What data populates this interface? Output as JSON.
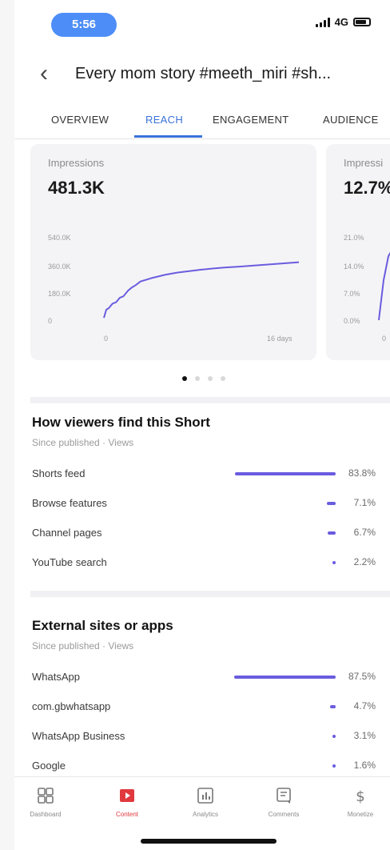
{
  "status_bar": {
    "time": "5:56",
    "network": "4G"
  },
  "header": {
    "title": "Every mom story  #meeth_miri #sh..."
  },
  "tabs": [
    {
      "label": "OVERVIEW"
    },
    {
      "label": "REACH"
    },
    {
      "label": "ENGAGEMENT"
    },
    {
      "label": "AUDIENCE"
    }
  ],
  "active_tab": "REACH",
  "cards": [
    {
      "label": "Impressions",
      "value": "481.3K",
      "chart_data": {
        "type": "line",
        "x": [
          0,
          0.2,
          0.4,
          0.7,
          1,
          1.3,
          1.6,
          2,
          2.3,
          2.6,
          3,
          4,
          5,
          6,
          7,
          8,
          9,
          10,
          11,
          12,
          13,
          14,
          15,
          16
        ],
        "y": [
          5,
          60,
          70,
          100,
          110,
          140,
          150,
          190,
          210,
          225,
          250,
          275,
          295,
          310,
          320,
          330,
          338,
          345,
          350,
          356,
          362,
          368,
          374,
          380
        ],
        "y_ticks": [
          "540.0K",
          "360.0K",
          "180.0K",
          "0"
        ],
        "x_ticks": [
          "0",
          "16 days"
        ],
        "ylim": [
          0,
          540
        ],
        "xlim": [
          0,
          16
        ],
        "color": "#6a5cdf"
      }
    },
    {
      "label": "Impressi",
      "value": "12.7%",
      "chart_data": {
        "type": "line",
        "y_ticks": [
          "21.0%",
          "14.0%",
          "7.0%",
          "0.0%"
        ],
        "x_ticks": [
          "0"
        ],
        "color": "#6a5cdf"
      }
    }
  ],
  "traffic_sources": {
    "title": "How viewers find this Short",
    "subtitle": "Since published · Views",
    "rows": [
      {
        "label": "Shorts feed",
        "percent": "83.8%",
        "value": 83.8
      },
      {
        "label": "Browse features",
        "percent": "7.1%",
        "value": 7.1
      },
      {
        "label": "Channel pages",
        "percent": "6.7%",
        "value": 6.7
      },
      {
        "label": "YouTube search",
        "percent": "2.2%",
        "value": 2.2
      }
    ]
  },
  "external_sites": {
    "title": "External sites or apps",
    "subtitle": "Since published · Views",
    "rows": [
      {
        "label": "WhatsApp",
        "percent": "87.5%",
        "value": 87.5
      },
      {
        "label": "com.gbwhatsapp",
        "percent": "4.7%",
        "value": 4.7
      },
      {
        "label": "WhatsApp Business",
        "percent": "3.1%",
        "value": 3.1
      },
      {
        "label": "Google",
        "percent": "1.6%",
        "value": 1.6
      }
    ]
  },
  "bottom_nav": [
    {
      "label": "Dashboard",
      "icon": "dashboard-icon"
    },
    {
      "label": "Content",
      "icon": "content-icon"
    },
    {
      "label": "Analytics",
      "icon": "analytics-icon"
    },
    {
      "label": "Comments",
      "icon": "comments-icon"
    },
    {
      "label": "Monetize",
      "icon": "monetize-icon"
    }
  ],
  "active_nav": "Content",
  "colors": {
    "accent": "#3a72d8",
    "bar": "#6a5cdf",
    "active_nav": "#e0393e",
    "time_pill": "#4d8df7"
  }
}
